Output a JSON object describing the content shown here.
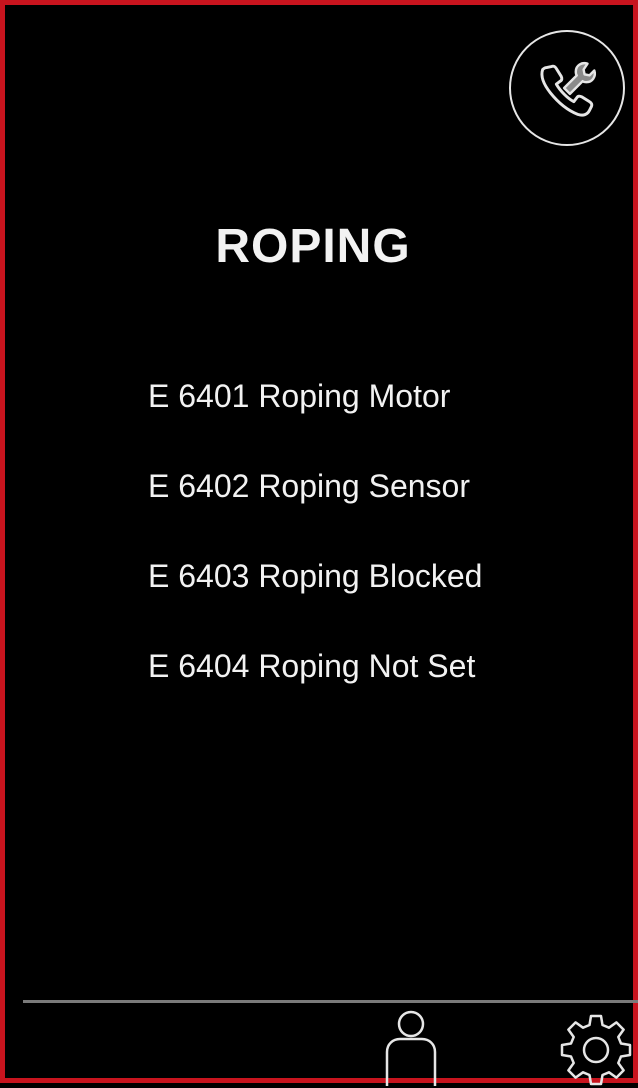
{
  "header": {
    "service_icon": "phone-wrench-icon"
  },
  "page": {
    "title": "ROPING"
  },
  "errors": [
    {
      "label": "E 6401 Roping Motor"
    },
    {
      "label": "E 6402 Roping Sensor"
    },
    {
      "label": "E 6403 Roping Blocked"
    },
    {
      "label": "E 6404 Roping Not Set"
    }
  ],
  "bottom_bar": {
    "user_icon": "user-icon",
    "settings_icon": "gear-icon"
  },
  "colors": {
    "frame_border": "#c8141e",
    "background": "#000000",
    "text": "#f2f2f2",
    "divider": "#7a7a7a"
  }
}
